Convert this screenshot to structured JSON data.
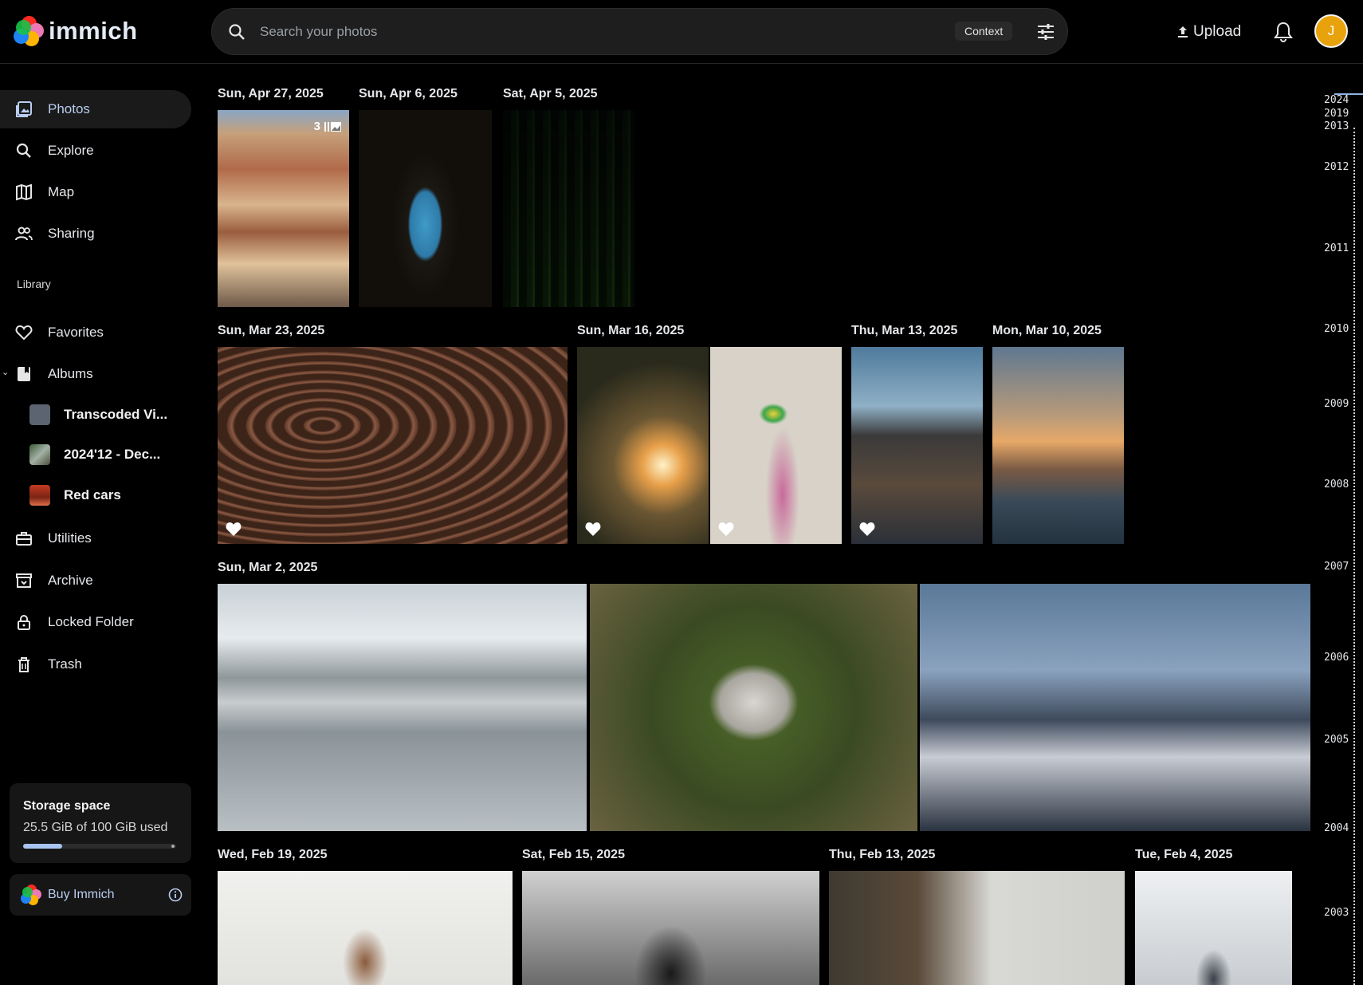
{
  "app": {
    "name": "immich"
  },
  "search": {
    "placeholder": "Search your photos",
    "context_chip": "Context"
  },
  "header": {
    "upload_label": "Upload",
    "avatar_initial": "J"
  },
  "sidebar": {
    "nav": [
      {
        "label": "Photos",
        "icon": "photos-icon",
        "active": true
      },
      {
        "label": "Explore",
        "icon": "search-icon"
      },
      {
        "label": "Map",
        "icon": "map-icon"
      },
      {
        "label": "Sharing",
        "icon": "people-icon"
      }
    ],
    "library_label": "Library",
    "library": [
      {
        "label": "Favorites",
        "icon": "heart-outline-icon"
      },
      {
        "label": "Albums",
        "icon": "albums-icon"
      }
    ],
    "albums": [
      {
        "label": "Transcoded Vi..."
      },
      {
        "label": "2024'12 - Dec..."
      },
      {
        "label": "Red cars"
      }
    ],
    "more": [
      {
        "label": "Utilities",
        "icon": "toolbox-icon"
      },
      {
        "label": "Archive",
        "icon": "archive-icon"
      },
      {
        "label": "Locked Folder",
        "icon": "lock-icon"
      },
      {
        "label": "Trash",
        "icon": "trash-icon"
      }
    ],
    "storage": {
      "title": "Storage space",
      "usage": "25.5 GiB of 100 GiB used",
      "used_fraction": 0.255
    },
    "buy_label": "Buy Immich"
  },
  "timeline": {
    "dates": [
      "Sun, Apr 27, 2025",
      "Sun, Apr 6, 2025",
      "Sat, Apr 5, 2025",
      "Sun, Mar 23, 2025",
      "Sun, Mar 16, 2025",
      "Thu, Mar 13, 2025",
      "Mon, Mar 10, 2025",
      "Sun, Mar 2, 2025",
      "Wed, Feb 19, 2025",
      "Sat, Feb 15, 2025",
      "Thu, Feb 13, 2025",
      "Tue, Feb 4, 2025"
    ],
    "stack_count": "3"
  },
  "scrubber": {
    "years": [
      "2024",
      "2019",
      "2013",
      "2012",
      "2011",
      "2010",
      "2009",
      "2008",
      "2007",
      "2006",
      "2005",
      "2004",
      "2003"
    ]
  }
}
